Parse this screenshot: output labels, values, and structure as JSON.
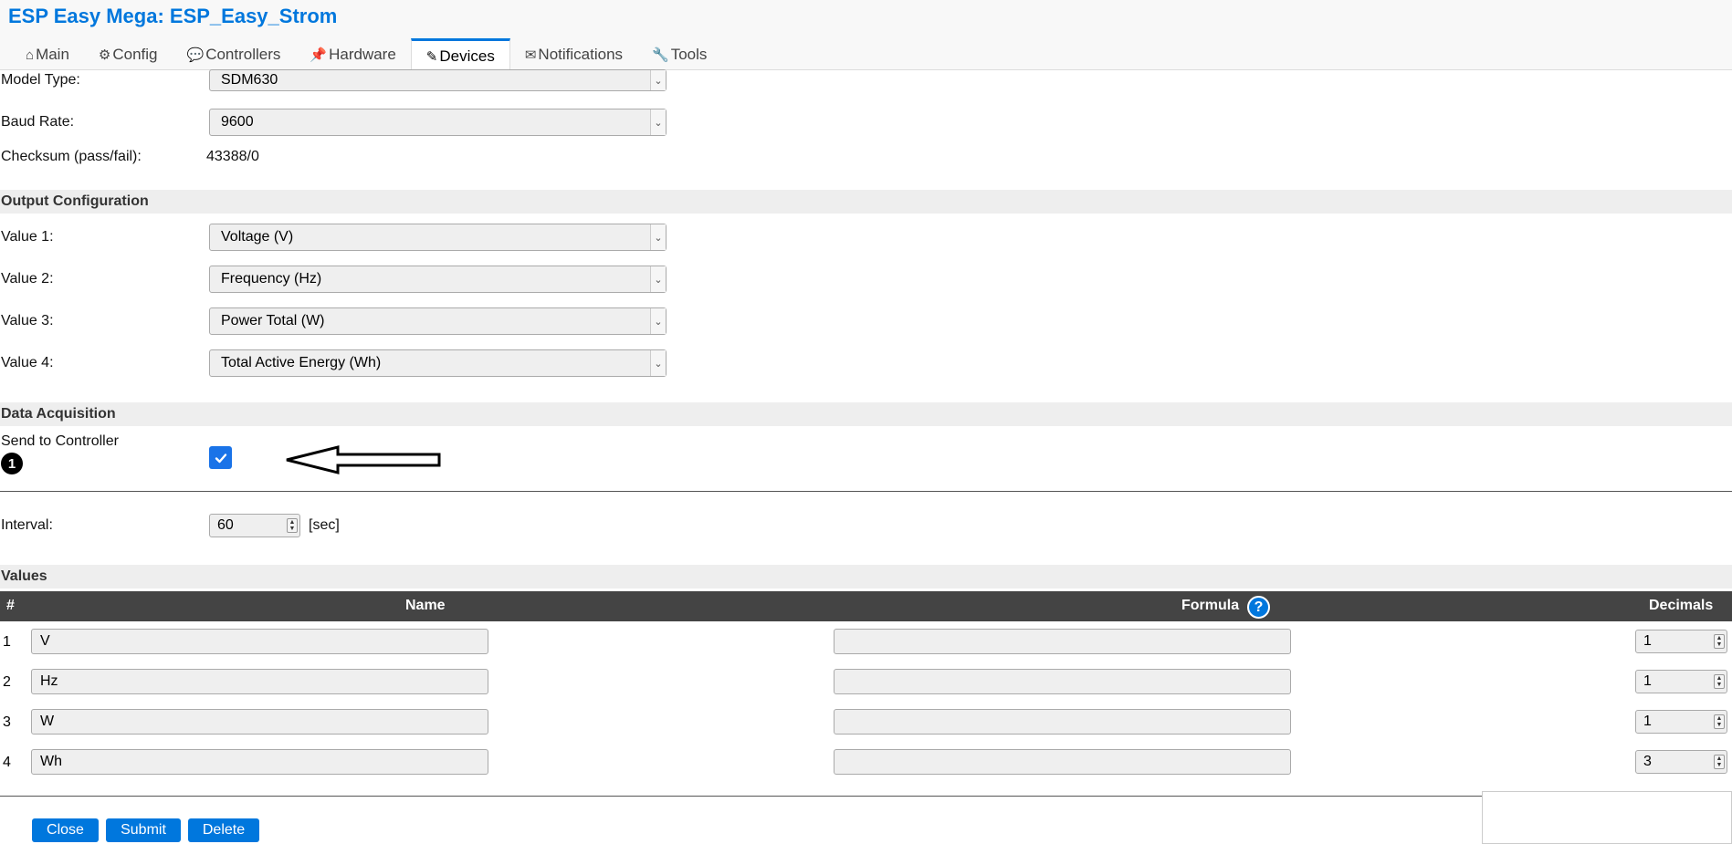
{
  "app": {
    "title": "ESP Easy Mega: ESP_Easy_Strom"
  },
  "tabs": [
    {
      "label": "Main",
      "icon": "⌂"
    },
    {
      "label": "Config",
      "icon": "⚙"
    },
    {
      "label": "Controllers",
      "icon": "💬"
    },
    {
      "label": "Hardware",
      "icon": "📌"
    },
    {
      "label": "Devices",
      "icon": "✎"
    },
    {
      "label": "Notifications",
      "icon": "✉"
    },
    {
      "label": "Tools",
      "icon": "🔧"
    }
  ],
  "device": {
    "model_type_label": "Model Type:",
    "model_type_value": "SDM630",
    "baud_rate_label": "Baud Rate:",
    "baud_rate_value": "9600",
    "checksum_label": "Checksum (pass/fail):",
    "checksum_value": "43388/0"
  },
  "output_config": {
    "heading": "Output Configuration",
    "values": [
      {
        "label": "Value 1:",
        "selected": "Voltage (V)"
      },
      {
        "label": "Value 2:",
        "selected": "Frequency (Hz)"
      },
      {
        "label": "Value 3:",
        "selected": "Power Total (W)"
      },
      {
        "label": "Value 4:",
        "selected": "Total Active Energy (Wh)"
      }
    ]
  },
  "data_acquisition": {
    "heading": "Data Acquisition",
    "send_to_controller_label": "Send to Controller",
    "send_to_controller_checked": true,
    "controller_number": "1",
    "interval_label": "Interval:",
    "interval_value": "60",
    "interval_unit": "[sec]"
  },
  "values_table": {
    "heading": "Values",
    "columns": {
      "index": "#",
      "name": "Name",
      "formula": "Formula",
      "decimals": "Decimals"
    },
    "help_glyph": "?",
    "rows": [
      {
        "index": "1",
        "name": "V",
        "formula": "",
        "decimals": "1"
      },
      {
        "index": "2",
        "name": "Hz",
        "formula": "",
        "decimals": "1"
      },
      {
        "index": "3",
        "name": "W",
        "formula": "",
        "decimals": "1"
      },
      {
        "index": "4",
        "name": "Wh",
        "formula": "",
        "decimals": "3"
      }
    ]
  },
  "buttons": {
    "close": "Close",
    "submit": "Submit",
    "delete": "Delete"
  },
  "colors": {
    "accent": "#0077dd",
    "table_header": "#444444",
    "checkbox": "#1a73e8"
  }
}
